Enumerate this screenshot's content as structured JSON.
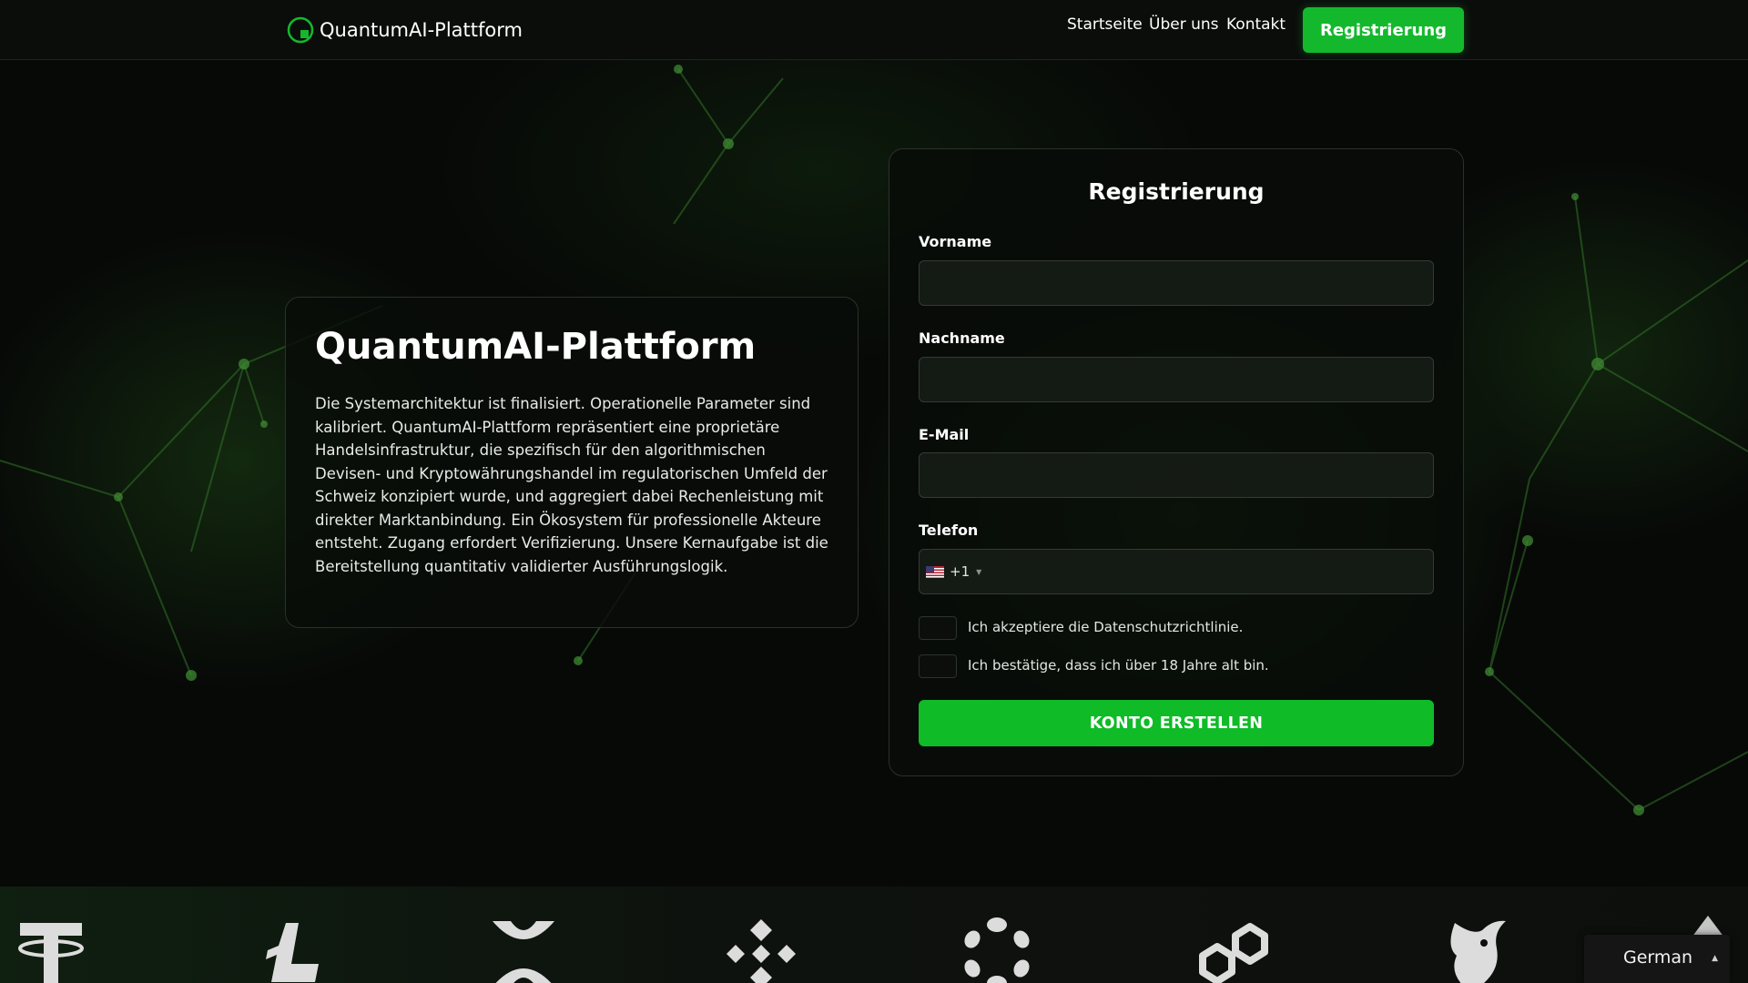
{
  "header": {
    "logo_text": "QuantumAI-Plattform",
    "nav": [
      "Startseite",
      "Über uns",
      "Kontakt"
    ],
    "cta_label": "Registrierung"
  },
  "hero": {
    "title": "QuantumAI-Plattform",
    "text": "Die Systemarchitektur ist finalisiert. Operationelle Parameter sind kalibriert. QuantumAI-Plattform repräsentiert eine proprietäre Handelsinfrastruktur, die spezifisch für den algorithmischen Devisen- und Kryptowährungshandel im regulatorischen Umfeld der Schweiz konzipiert wurde, und aggregiert dabei Rechenleistung mit direkter Marktanbindung. Ein Ökosystem für professionelle Akteure entsteht. Zugang erfordert Verifizierung. Unsere Kernaufgabe ist die Bereitstellung quantitativ validierter Ausführungslogik."
  },
  "form": {
    "title": "Registrierung",
    "first_name_label": "Vorname",
    "first_name_value": "",
    "last_name_label": "Nachname",
    "last_name_value": "",
    "email_label": "E-Mail",
    "email_value": "",
    "phone_label": "Telefon",
    "phone_prefix": "+1",
    "phone_value": "",
    "checkbox_privacy": "Ich akzeptiere die Datenschutzrichtlinie.",
    "checkbox_age": "Ich bestätige, dass ich über 18 Jahre alt bin.",
    "submit_label": "KONTO ERSTELLEN"
  },
  "coins": [
    "tether-icon",
    "litecoin-icon",
    "xrp-icon",
    "binance-icon",
    "polkadot-icon",
    "polygon-icon",
    "uniswap-icon"
  ],
  "language": {
    "selected": "German"
  },
  "colors": {
    "accent": "#14b82d",
    "background": "#070907"
  }
}
